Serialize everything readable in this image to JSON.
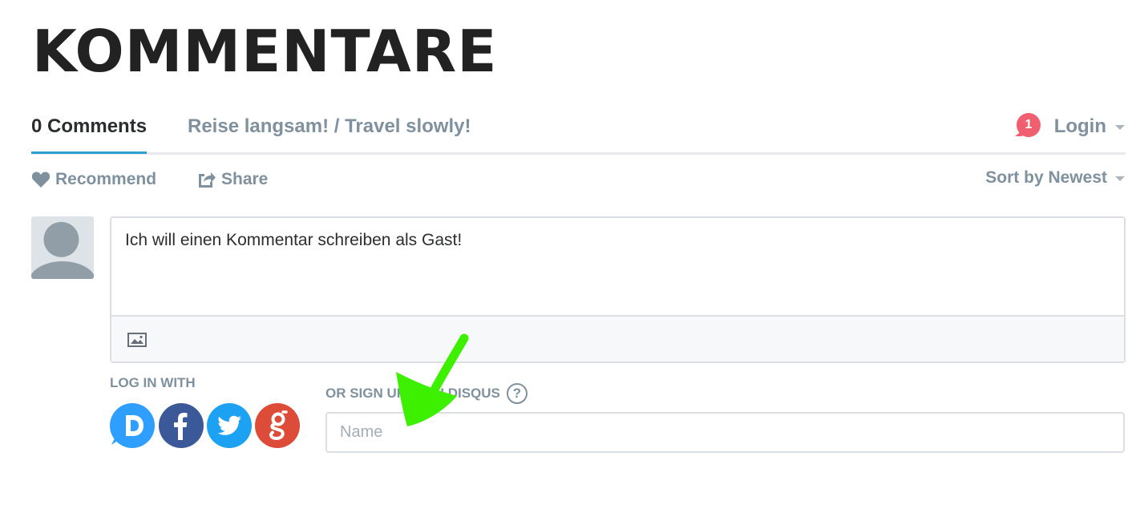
{
  "page": {
    "title": "KOMMENTARE"
  },
  "nav": {
    "comments_tab": "0 Comments",
    "community_tab": "Reise langsam! / Travel slowly!",
    "notification_count": "1",
    "login_label": "Login"
  },
  "actions": {
    "recommend_label": "Recommend",
    "share_label": "Share",
    "sort_label": "Sort by Newest"
  },
  "composer": {
    "text": "Ich will einen Kommentar schreiben als Gast!"
  },
  "auth": {
    "login_with_label": "LOG IN WITH",
    "signup_label": "OR SIGN UP WITH DISQUS",
    "help_label": "?",
    "name_placeholder": "Name",
    "providers": [
      "disqus",
      "facebook",
      "twitter",
      "google"
    ]
  },
  "colors": {
    "accent": "#2e9fce",
    "notification": "#f05f70",
    "muted_text": "#7f919e",
    "annotation_arrow": "#3df000"
  },
  "icons": {
    "recommend": "heart-icon",
    "share": "share-icon",
    "image_upload": "image-icon",
    "avatar": "user-avatar-icon",
    "annotation": "arrow-annotation-icon"
  }
}
